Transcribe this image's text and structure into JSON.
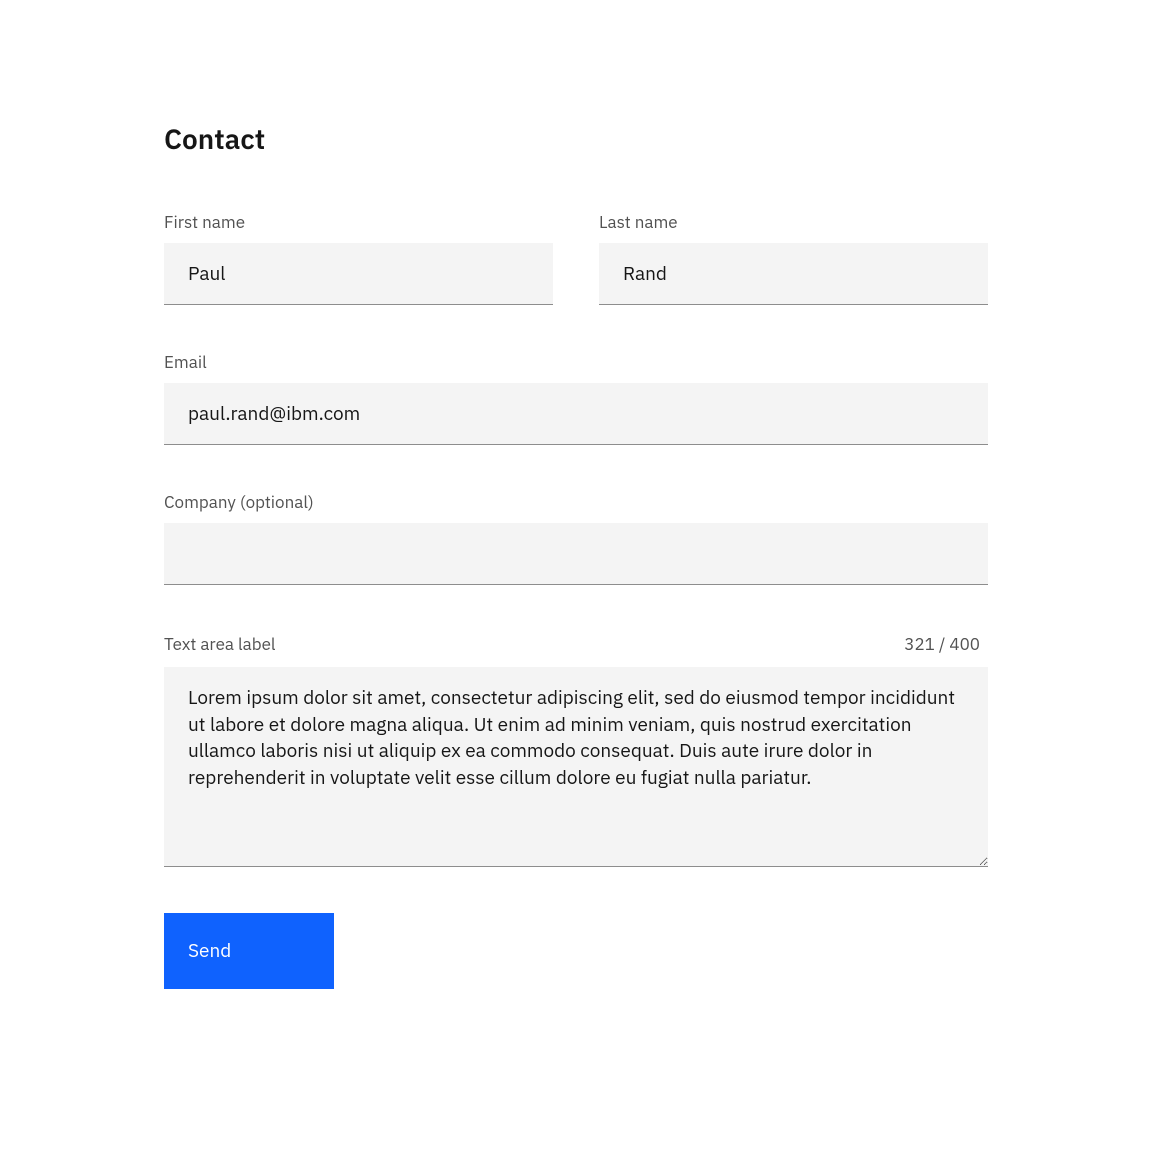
{
  "form": {
    "title": "Contact",
    "fields": {
      "first_name": {
        "label": "First name",
        "value": "Paul"
      },
      "last_name": {
        "label": "Last name",
        "value": "Rand"
      },
      "email": {
        "label": "Email",
        "value": "paul.rand@ibm.com"
      },
      "company": {
        "label": "Company (optional)",
        "value": ""
      },
      "message": {
        "label": "Text area label",
        "value": "Lorem ipsum dolor sit amet, consectetur adipiscing elit, sed do eiusmod tempor incididunt ut labore et dolore magna aliqua. Ut enim ad minim veniam, quis nostrud exercitation ullamco laboris nisi ut aliquip ex ea commodo consequat. Duis aute irure dolor in reprehenderit in voluptate velit esse cillum dolore eu fugiat nulla pariatur.",
        "counter": "321 / 400"
      }
    },
    "submit_label": "Send"
  },
  "colors": {
    "primary": "#0f62fe",
    "field_bg": "#f4f4f4",
    "text": "#161616",
    "label": "#525252"
  }
}
